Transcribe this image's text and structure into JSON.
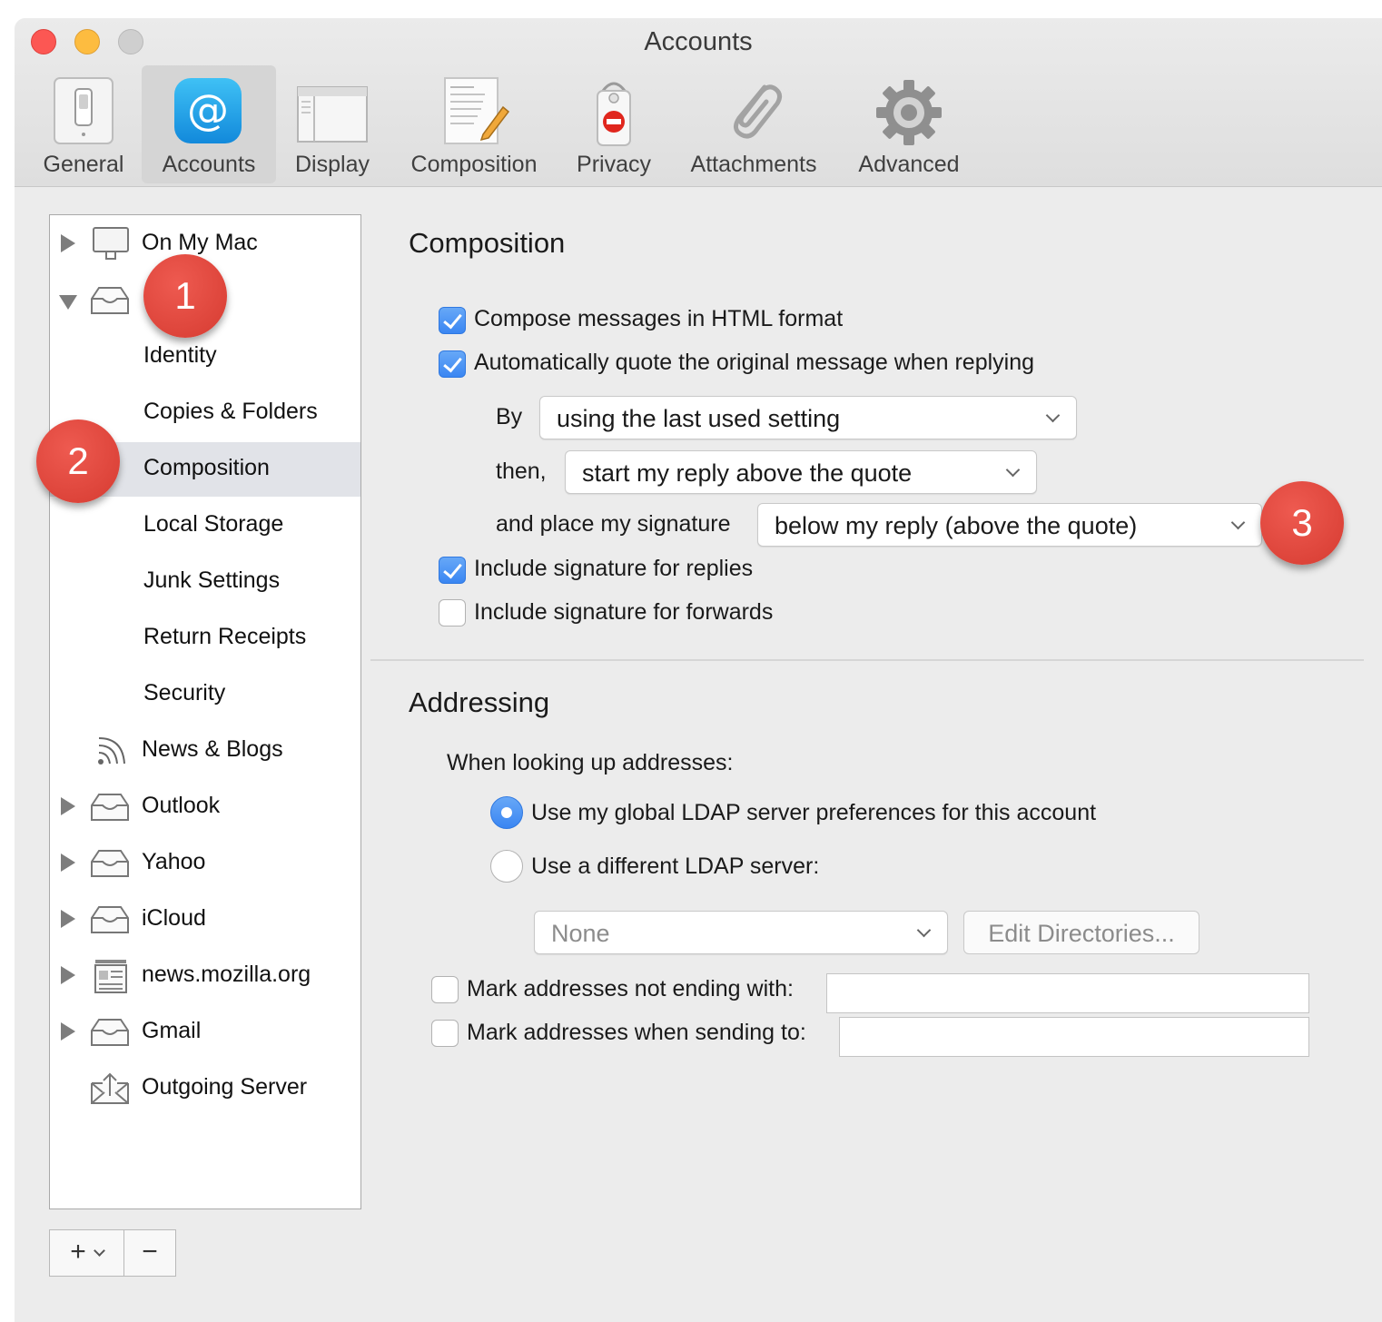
{
  "window": {
    "title": "Accounts"
  },
  "toolbar": {
    "items": [
      {
        "label": "General",
        "icon": "switch-icon"
      },
      {
        "label": "Accounts",
        "icon": "at-sign-icon"
      },
      {
        "label": "Display",
        "icon": "window-icon"
      },
      {
        "label": "Composition",
        "icon": "letter-pencil-icon"
      },
      {
        "label": "Privacy",
        "icon": "do-not-disturb-tag-icon"
      },
      {
        "label": "Attachments",
        "icon": "paperclip-icon"
      },
      {
        "label": "Advanced",
        "icon": "gear-icon"
      }
    ],
    "active": "Accounts"
  },
  "sidebar": {
    "items": [
      {
        "label": "On My Mac",
        "icon": "computer-icon"
      },
      {
        "label": "",
        "icon": "inbox-tray-icon"
      },
      {
        "label": "Identity"
      },
      {
        "label": "Copies & Folders"
      },
      {
        "label": "Composition",
        "selected": true
      },
      {
        "label": "Local Storage"
      },
      {
        "label": "Junk Settings"
      },
      {
        "label": "Return Receipts"
      },
      {
        "label": "Security"
      },
      {
        "label": "News & Blogs",
        "icon": "rss-icon"
      },
      {
        "label": "Outlook",
        "icon": "inbox-tray-icon"
      },
      {
        "label": "Yahoo",
        "icon": "inbox-tray-icon"
      },
      {
        "label": "iCloud",
        "icon": "inbox-tray-icon"
      },
      {
        "label": "news.mozilla.org",
        "icon": "newspaper-icon"
      },
      {
        "label": "Gmail",
        "icon": "inbox-tray-icon"
      },
      {
        "label": "Outgoing Server",
        "icon": "outgoing-envelope-icon"
      }
    ],
    "add_label": "+",
    "remove_label": "−"
  },
  "composition": {
    "title": "Composition",
    "html_format": {
      "label": "Compose messages in HTML format",
      "checked": true
    },
    "auto_quote": {
      "label": "Automatically quote the original message when replying",
      "checked": true
    },
    "by_label": "By",
    "by_value": "using the last used setting",
    "then_label": "then,",
    "then_value": "start my reply above the quote",
    "signature_label": "and place my signature",
    "signature_value": "below my reply (above the quote)",
    "sig_replies": {
      "label": "Include signature for replies",
      "checked": true
    },
    "sig_forwards": {
      "label": "Include signature for forwards",
      "checked": false
    }
  },
  "addressing": {
    "title": "Addressing",
    "lookup_label": "When looking up addresses:",
    "global_ldap": {
      "label": "Use my global LDAP server preferences for this account",
      "selected": true
    },
    "different_ldap": {
      "label": "Use a different LDAP server:",
      "selected": false
    },
    "server_value": "None",
    "edit_directories": "Edit Directories...",
    "mark_not_ending": {
      "label": "Mark addresses not ending with:",
      "checked": false,
      "value": ""
    },
    "mark_sending": {
      "label": "Mark addresses when sending to:",
      "checked": false,
      "value": ""
    }
  },
  "callouts": [
    "1",
    "2",
    "3"
  ],
  "colors": {
    "accent": "#3a86f2",
    "callout": "#d63b31",
    "selection": "#e1e3e8"
  }
}
